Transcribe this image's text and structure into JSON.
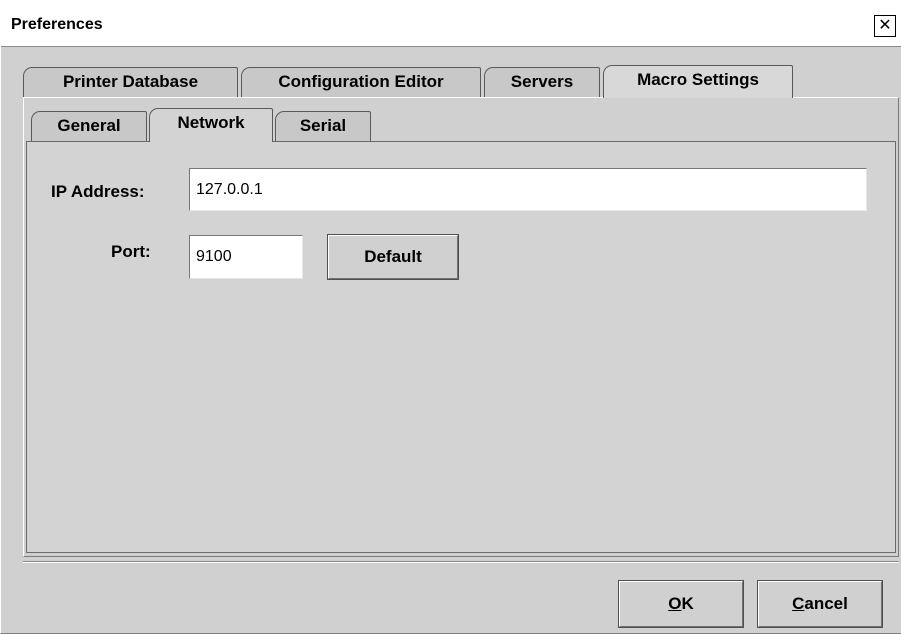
{
  "window": {
    "title": "Preferences",
    "close_glyph": "✕"
  },
  "outer_tabs": [
    {
      "label": "Printer Database",
      "selected": false
    },
    {
      "label": "Configuration Editor",
      "selected": false
    },
    {
      "label": "Servers",
      "selected": false
    },
    {
      "label": "Macro Settings",
      "selected": true
    }
  ],
  "inner_tabs": [
    {
      "label": "General",
      "selected": false
    },
    {
      "label": "Network",
      "selected": true
    },
    {
      "label": "Serial",
      "selected": false
    }
  ],
  "network": {
    "ip_label": "IP Address:",
    "ip_value": "127.0.0.1",
    "port_label": "Port:",
    "port_value": "9100",
    "default_button": "Default"
  },
  "footer": {
    "ok_mnemonic": "O",
    "ok_rest": "K",
    "cancel_mnemonic": "C",
    "cancel_rest": "ancel"
  }
}
